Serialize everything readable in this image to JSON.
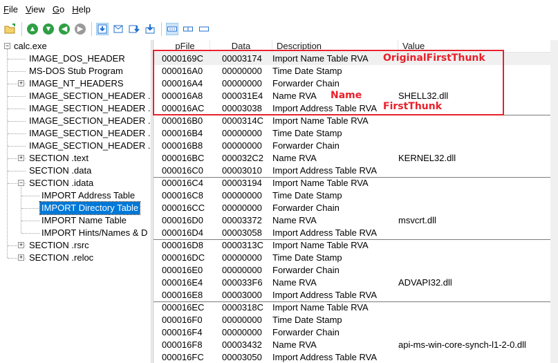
{
  "menu": [
    {
      "label": "File",
      "underline": "F",
      "rest": "ile"
    },
    {
      "label": "View",
      "underline": "V",
      "rest": "iew"
    },
    {
      "label": "Go",
      "underline": "G",
      "rest": "o"
    },
    {
      "label": "Help",
      "underline": "H",
      "rest": "elp"
    }
  ],
  "toolbar": {
    "icons": [
      "open-file-icon",
      "go-up-icon",
      "go-down-icon",
      "go-back-icon",
      "go-forward-icon",
      "view-hex-icon",
      "view-mail-icon",
      "view-down-icon",
      "view-import-icon",
      "view-details-icon",
      "view-list-icon",
      "view-single-icon"
    ]
  },
  "tree": {
    "root": "calc.exe",
    "items": [
      {
        "label": "IMAGE_DOS_HEADER",
        "expandable": false
      },
      {
        "label": "MS-DOS Stub Program",
        "expandable": false
      },
      {
        "label": "IMAGE_NT_HEADERS",
        "expandable": true
      },
      {
        "label": "IMAGE_SECTION_HEADER .",
        "expandable": false
      },
      {
        "label": "IMAGE_SECTION_HEADER .",
        "expandable": false
      },
      {
        "label": "IMAGE_SECTION_HEADER .",
        "expandable": false
      },
      {
        "label": "IMAGE_SECTION_HEADER .",
        "expandable": false
      },
      {
        "label": "IMAGE_SECTION_HEADER .",
        "expandable": false
      },
      {
        "label": "SECTION .text",
        "expandable": true
      },
      {
        "label": "SECTION .data",
        "expandable": false
      },
      {
        "label": "SECTION .idata",
        "expandable": true,
        "expanded": true
      },
      {
        "label": "SECTION .rsrc",
        "expandable": true
      },
      {
        "label": "SECTION .reloc",
        "expandable": true
      }
    ],
    "idata_children": [
      "IMPORT Address Table",
      "IMPORT Directory Table",
      "IMPORT Name Table",
      "IMPORT Hints/Names & D"
    ],
    "selected": "IMPORT Directory Table"
  },
  "list": {
    "columns": [
      "pFile",
      "Data",
      "Description",
      "Value"
    ],
    "rows": [
      {
        "pfile": "0000169C",
        "data": "00003174",
        "desc": "Import Name Table RVA",
        "value": ""
      },
      {
        "pfile": "000016A0",
        "data": "00000000",
        "desc": "Time Date Stamp",
        "value": ""
      },
      {
        "pfile": "000016A4",
        "data": "00000000",
        "desc": "Forwarder Chain",
        "value": ""
      },
      {
        "pfile": "000016A8",
        "data": "000031E4",
        "desc": "Name RVA",
        "value": "SHELL32.dll"
      },
      {
        "pfile": "000016AC",
        "data": "00003038",
        "desc": "Import Address Table RVA",
        "value": ""
      },
      {
        "pfile": "000016B0",
        "data": "0000314C",
        "desc": "Import Name Table RVA",
        "value": ""
      },
      {
        "pfile": "000016B4",
        "data": "00000000",
        "desc": "Time Date Stamp",
        "value": ""
      },
      {
        "pfile": "000016B8",
        "data": "00000000",
        "desc": "Forwarder Chain",
        "value": ""
      },
      {
        "pfile": "000016BC",
        "data": "000032C2",
        "desc": "Name RVA",
        "value": "KERNEL32.dll"
      },
      {
        "pfile": "000016C0",
        "data": "00003010",
        "desc": "Import Address Table RVA",
        "value": ""
      },
      {
        "pfile": "000016C4",
        "data": "00003194",
        "desc": "Import Name Table RVA",
        "value": ""
      },
      {
        "pfile": "000016C8",
        "data": "00000000",
        "desc": "Time Date Stamp",
        "value": ""
      },
      {
        "pfile": "000016CC",
        "data": "00000000",
        "desc": "Forwarder Chain",
        "value": ""
      },
      {
        "pfile": "000016D0",
        "data": "00003372",
        "desc": "Name RVA",
        "value": "msvcrt.dll"
      },
      {
        "pfile": "000016D4",
        "data": "00003058",
        "desc": "Import Address Table RVA",
        "value": ""
      },
      {
        "pfile": "000016D8",
        "data": "0000313C",
        "desc": "Import Name Table RVA",
        "value": ""
      },
      {
        "pfile": "000016DC",
        "data": "00000000",
        "desc": "Time Date Stamp",
        "value": ""
      },
      {
        "pfile": "000016E0",
        "data": "00000000",
        "desc": "Forwarder Chain",
        "value": ""
      },
      {
        "pfile": "000016E4",
        "data": "000033F6",
        "desc": "Name RVA",
        "value": "ADVAPI32.dll"
      },
      {
        "pfile": "000016E8",
        "data": "00003000",
        "desc": "Import Address Table RVA",
        "value": ""
      },
      {
        "pfile": "000016EC",
        "data": "0000318C",
        "desc": "Import Name Table RVA",
        "value": ""
      },
      {
        "pfile": "000016F0",
        "data": "00000000",
        "desc": "Time Date Stamp",
        "value": ""
      },
      {
        "pfile": "000016F4",
        "data": "00000000",
        "desc": "Forwarder Chain",
        "value": ""
      },
      {
        "pfile": "000016F8",
        "data": "00003432",
        "desc": "Name RVA",
        "value": "api-ms-win-core-synch-l1-2-0.dll"
      },
      {
        "pfile": "000016FC",
        "data": "00003050",
        "desc": "Import Address Table RVA",
        "value": ""
      }
    ],
    "highlighted_row": 0
  },
  "annotations": {
    "original_first_thunk": "OriginalFirstThunk",
    "name": "Name",
    "first_thunk": "FirstThunk",
    "color": "#e8202a"
  },
  "colors": {
    "selection": "#0078d7",
    "toolbar_green": "#2ea043",
    "toolbar_blue": "#1f6fd0"
  }
}
